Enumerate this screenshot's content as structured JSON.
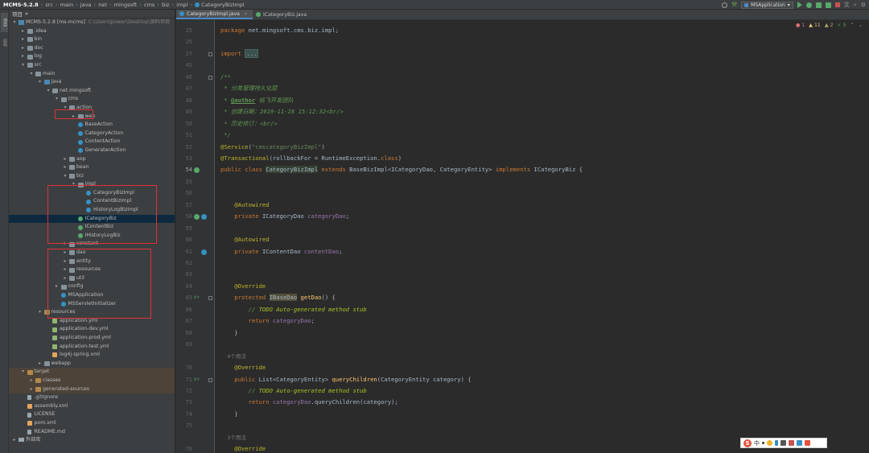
{
  "breadcrumbs": [
    {
      "label": "MCMS-5.2.8"
    },
    {
      "label": "src"
    },
    {
      "label": "main"
    },
    {
      "label": "java"
    },
    {
      "label": "net"
    },
    {
      "label": "mingsoft"
    },
    {
      "label": "cms"
    },
    {
      "label": "biz"
    },
    {
      "label": "impl"
    },
    {
      "label": "CategoryBizImpl",
      "icon": "class-icon"
    }
  ],
  "toolbar": {
    "run_config": "MSApplication"
  },
  "left_stripe": {
    "project": "项目",
    "structure": "结构"
  },
  "project_panel": {
    "title": "项目"
  },
  "tree": [
    {
      "label": "MCMS-5.2.8 [ms-mcms]",
      "extra": "C:\\Users\\power\\Desktop\\源码项目",
      "depth": 0,
      "icon": "module",
      "arrow": "▾"
    },
    {
      "label": ".idea",
      "depth": 1,
      "icon": "folder",
      "arrow": "▸"
    },
    {
      "label": "bin",
      "depth": 1,
      "icon": "folder",
      "arrow": "▸"
    },
    {
      "label": "doc",
      "depth": 1,
      "icon": "folder",
      "arrow": "▸"
    },
    {
      "label": "log",
      "depth": 1,
      "icon": "folder",
      "arrow": "▸"
    },
    {
      "label": "src",
      "depth": 1,
      "icon": "folder",
      "arrow": "▾"
    },
    {
      "label": "main",
      "depth": 2,
      "icon": "folder",
      "arrow": "▾"
    },
    {
      "label": "java",
      "depth": 3,
      "icon": "src",
      "arrow": "▾"
    },
    {
      "label": "net.mingsoft",
      "depth": 4,
      "icon": "pkg",
      "arrow": "▾"
    },
    {
      "label": "cms",
      "depth": 5,
      "icon": "pkg",
      "arrow": "▾"
    },
    {
      "label": "action",
      "depth": 6,
      "icon": "pkg",
      "arrow": "▾"
    },
    {
      "label": "web",
      "depth": 7,
      "icon": "pkg",
      "arrow": "▸"
    },
    {
      "label": "BaseAction",
      "depth": 7,
      "icon": "cls",
      "arrow": ""
    },
    {
      "label": "CategoryAction",
      "depth": 7,
      "icon": "cls",
      "arrow": ""
    },
    {
      "label": "ContentAction",
      "depth": 7,
      "icon": "cls",
      "arrow": ""
    },
    {
      "label": "GeneraterAction",
      "depth": 7,
      "icon": "cls",
      "arrow": ""
    },
    {
      "label": "aop",
      "depth": 6,
      "icon": "pkg",
      "arrow": "▸"
    },
    {
      "label": "bean",
      "depth": 6,
      "icon": "pkg",
      "arrow": "▸"
    },
    {
      "label": "biz",
      "depth": 6,
      "icon": "pkg",
      "arrow": "▾"
    },
    {
      "label": "impl",
      "depth": 7,
      "icon": "pkg",
      "arrow": "▾"
    },
    {
      "label": "CategoryBizImpl",
      "depth": 8,
      "icon": "cls",
      "arrow": ""
    },
    {
      "label": "ContentBizImpl",
      "depth": 8,
      "icon": "cls",
      "arrow": ""
    },
    {
      "label": "HistoryLogBizImpl",
      "depth": 8,
      "icon": "cls",
      "arrow": ""
    },
    {
      "label": "ICategoryBiz",
      "depth": 7,
      "icon": "iface",
      "arrow": "",
      "selected": true
    },
    {
      "label": "IContentBiz",
      "depth": 7,
      "icon": "iface",
      "arrow": ""
    },
    {
      "label": "IHistoryLogBiz",
      "depth": 7,
      "icon": "iface",
      "arrow": ""
    },
    {
      "label": "constant",
      "depth": 6,
      "icon": "pkg",
      "arrow": "▸"
    },
    {
      "label": "dao",
      "depth": 6,
      "icon": "pkg",
      "arrow": "▸"
    },
    {
      "label": "entity",
      "depth": 6,
      "icon": "pkg",
      "arrow": "▸"
    },
    {
      "label": "resources",
      "depth": 6,
      "icon": "pkg",
      "arrow": "▸"
    },
    {
      "label": "util",
      "depth": 6,
      "icon": "pkg",
      "arrow": "▸"
    },
    {
      "label": "config",
      "depth": 5,
      "icon": "pkg",
      "arrow": "▸"
    },
    {
      "label": "MSApplication",
      "depth": 5,
      "icon": "cls",
      "arrow": ""
    },
    {
      "label": "MSServletInitializer",
      "depth": 5,
      "icon": "cls",
      "arrow": ""
    },
    {
      "label": "resources",
      "depth": 3,
      "icon": "res",
      "arrow": "▾"
    },
    {
      "label": "application.yml",
      "depth": 4,
      "icon": "yml",
      "arrow": ""
    },
    {
      "label": "application-dev.yml",
      "depth": 4,
      "icon": "yml",
      "arrow": ""
    },
    {
      "label": "application-prod.yml",
      "depth": 4,
      "icon": "yml",
      "arrow": ""
    },
    {
      "label": "application-test.yml",
      "depth": 4,
      "icon": "yml",
      "arrow": ""
    },
    {
      "label": "log4j-spring.xml",
      "depth": 4,
      "icon": "xml",
      "arrow": ""
    },
    {
      "label": "webapp",
      "depth": 3,
      "icon": "folder",
      "arrow": "▸"
    },
    {
      "label": "target",
      "depth": 1,
      "icon": "target",
      "arrow": "▾",
      "target_bg": true
    },
    {
      "label": "classes",
      "depth": 2,
      "icon": "target",
      "arrow": "▸",
      "target_bg": true
    },
    {
      "label": "generated-sources",
      "depth": 2,
      "icon": "target",
      "arrow": "▸",
      "target_bg": true
    },
    {
      "label": ".gitignore",
      "depth": 1,
      "icon": "file",
      "arrow": ""
    },
    {
      "label": "assembly.xml",
      "depth": 1,
      "icon": "xml",
      "arrow": ""
    },
    {
      "label": "LICENSE",
      "depth": 1,
      "icon": "file",
      "arrow": ""
    },
    {
      "label": "pom.xml",
      "depth": 1,
      "icon": "xml",
      "arrow": ""
    },
    {
      "label": "README.md",
      "depth": 1,
      "icon": "file",
      "arrow": ""
    },
    {
      "label": "外部库",
      "depth": 0,
      "icon": "lib",
      "arrow": "▸"
    }
  ],
  "editor": {
    "tabs": [
      {
        "label": "CategoryBizImpl.java",
        "active": true,
        "color": "#3592c4"
      },
      {
        "label": "ICategoryBiz.java",
        "active": false,
        "color": "#59a869"
      }
    ],
    "inspections": {
      "errors": "1",
      "warnings": "11",
      "weak": "2",
      "ok": "5"
    }
  },
  "code_lines": [
    {
      "num": "25",
      "tokens": [
        [
          "kw",
          "package "
        ],
        [
          "txt",
          "net.mingsoft.cms.biz.impl;"
        ]
      ]
    },
    {
      "num": "26",
      "tokens": []
    },
    {
      "num": "27",
      "tokens": [
        [
          "kw",
          "import "
        ],
        [
          "fold-dots",
          "..."
        ]
      ]
    },
    {
      "num": "45",
      "tokens": []
    },
    {
      "num": "46",
      "tokens": [
        [
          "cm",
          "/**"
        ]
      ]
    },
    {
      "num": "47",
      "tokens": [
        [
          "cm",
          " * 分类管理持久化层"
        ]
      ]
    },
    {
      "num": "48",
      "tokens": [
        [
          "cm",
          " * "
        ],
        [
          "doc-tag",
          "@author"
        ],
        [
          "cm",
          " 铭飞开发团队"
        ]
      ]
    },
    {
      "num": "49",
      "tokens": [
        [
          "cm",
          " * 创建日期：2019-11-28 15:12:32<br/>"
        ]
      ]
    },
    {
      "num": "50",
      "tokens": [
        [
          "cm",
          " * 历史修订：<br/>"
        ]
      ]
    },
    {
      "num": "51",
      "tokens": [
        [
          "cm",
          " */"
        ]
      ]
    },
    {
      "num": "52",
      "tokens": [
        [
          "ann",
          "@Service"
        ],
        [
          "txt",
          "("
        ],
        [
          "str",
          "\"cmscategoryBizImpl\""
        ],
        [
          "txt",
          ")"
        ]
      ]
    },
    {
      "num": "53",
      "tokens": [
        [
          "ann",
          "@Transactional"
        ],
        [
          "txt",
          "(rollbackFor = RuntimeException."
        ],
        [
          "kw",
          "class"
        ],
        [
          "txt",
          ")"
        ]
      ]
    },
    {
      "num": "54",
      "tokens": [
        [
          "kw",
          "public class "
        ],
        [
          "hl-occ",
          "CategoryBizImpl"
        ],
        [
          "kw",
          " extends "
        ],
        [
          "txt",
          "BaseBizImpl<ICategoryDao, CategoryEntity> "
        ],
        [
          "kw",
          "implements "
        ],
        [
          "txt",
          "ICategoryBiz {"
        ]
      ]
    },
    {
      "num": "55",
      "tokens": []
    },
    {
      "num": "56",
      "tokens": []
    },
    {
      "num": "57",
      "tokens": [
        [
          "ann",
          "    @Autowired"
        ]
      ]
    },
    {
      "num": "58",
      "tokens": [
        [
          "kw",
          "    private "
        ],
        [
          "txt",
          "ICategoryDao "
        ],
        [
          "fld",
          "categoryDao"
        ],
        [
          "txt",
          ";"
        ]
      ]
    },
    {
      "num": "59",
      "tokens": []
    },
    {
      "num": "60",
      "tokens": [
        [
          "ann",
          "    @Autowired"
        ]
      ]
    },
    {
      "num": "61",
      "tokens": [
        [
          "kw",
          "    private "
        ],
        [
          "txt",
          "IContentDao "
        ],
        [
          "fld",
          "contentDao"
        ],
        [
          "txt",
          ";"
        ]
      ]
    },
    {
      "num": "62",
      "tokens": []
    },
    {
      "num": "63",
      "tokens": []
    },
    {
      "num": "64",
      "tokens": [
        [
          "ann",
          "    @Override"
        ]
      ]
    },
    {
      "num": "65",
      "tokens": [
        [
          "kw",
          "    protected "
        ],
        [
          "hl-warn",
          "IBaseDao"
        ],
        [
          "txt",
          " "
        ],
        [
          "mth",
          "getDao"
        ],
        [
          "txt",
          "() {"
        ]
      ]
    },
    {
      "num": "66",
      "tokens": [
        [
          "cm",
          "        // "
        ],
        [
          "todo",
          "TODO Auto-generated method stub"
        ]
      ]
    },
    {
      "num": "67",
      "tokens": [
        [
          "kw",
          "        return "
        ],
        [
          "fld",
          "categoryDao"
        ],
        [
          "txt",
          ";"
        ]
      ]
    },
    {
      "num": "68",
      "tokens": [
        [
          "txt",
          "    }"
        ]
      ]
    },
    {
      "num": "69",
      "tokens": []
    },
    {
      "num": "",
      "tokens": [
        [
          "hint",
          "    4个用法"
        ]
      ]
    },
    {
      "num": "70",
      "tokens": [
        [
          "ann",
          "    @Override"
        ]
      ]
    },
    {
      "num": "71",
      "tokens": [
        [
          "kw",
          "    public "
        ],
        [
          "txt",
          "List<CategoryEntity> "
        ],
        [
          "mth",
          "queryChildren"
        ],
        [
          "txt",
          "(CategoryEntity category) {"
        ]
      ]
    },
    {
      "num": "72",
      "tokens": [
        [
          "cm",
          "        // "
        ],
        [
          "todo",
          "TODO Auto-generated method stub"
        ]
      ]
    },
    {
      "num": "73",
      "tokens": [
        [
          "kw",
          "        return "
        ],
        [
          "fld",
          "categoryDao"
        ],
        [
          "txt",
          ".queryChildren(category);"
        ]
      ]
    },
    {
      "num": "74",
      "tokens": [
        [
          "txt",
          "    }"
        ]
      ]
    },
    {
      "num": "75",
      "tokens": []
    },
    {
      "num": "",
      "tokens": [
        [
          "hint",
          "    3个用法"
        ]
      ]
    },
    {
      "num": "76",
      "tokens": [
        [
          "ann",
          "    @Override"
        ]
      ]
    }
  ],
  "ime": {
    "zh": "中"
  }
}
